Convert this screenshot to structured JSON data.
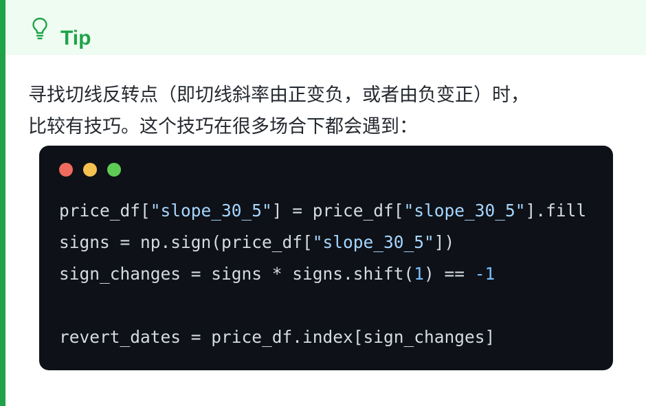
{
  "admonition": {
    "title": "Tip",
    "icon": "lightbulb-icon",
    "accent_color": "#1fa34a",
    "header_background": "#effcf1"
  },
  "paragraph": {
    "line1": "寻找切线反转点（即切线斜率由正变负，或者由负变正）时，",
    "line2": "比较有技巧。这个技巧在很多场合下都会遇到："
  },
  "code_block": {
    "window_controls": [
      "close",
      "minimize",
      "maximize"
    ],
    "lines": [
      [
        {
          "t": "text",
          "v": "price_df["
        },
        {
          "t": "str",
          "v": "\"slope_30_5\""
        },
        {
          "t": "text",
          "v": "] = price_df["
        },
        {
          "t": "str",
          "v": "\"slope_30_5\""
        },
        {
          "t": "text",
          "v": "].fill"
        }
      ],
      [
        {
          "t": "text",
          "v": "signs = np.sign(price_df["
        },
        {
          "t": "str",
          "v": "\"slope_30_5\""
        },
        {
          "t": "text",
          "v": "])"
        }
      ],
      [
        {
          "t": "text",
          "v": "sign_changes = signs * signs.shift("
        },
        {
          "t": "num",
          "v": "1"
        },
        {
          "t": "text",
          "v": ") == "
        },
        {
          "t": "num",
          "v": "-1"
        }
      ],
      [],
      [
        {
          "t": "text",
          "v": "revert_dates = price_df.index[sign_changes]"
        }
      ]
    ]
  }
}
